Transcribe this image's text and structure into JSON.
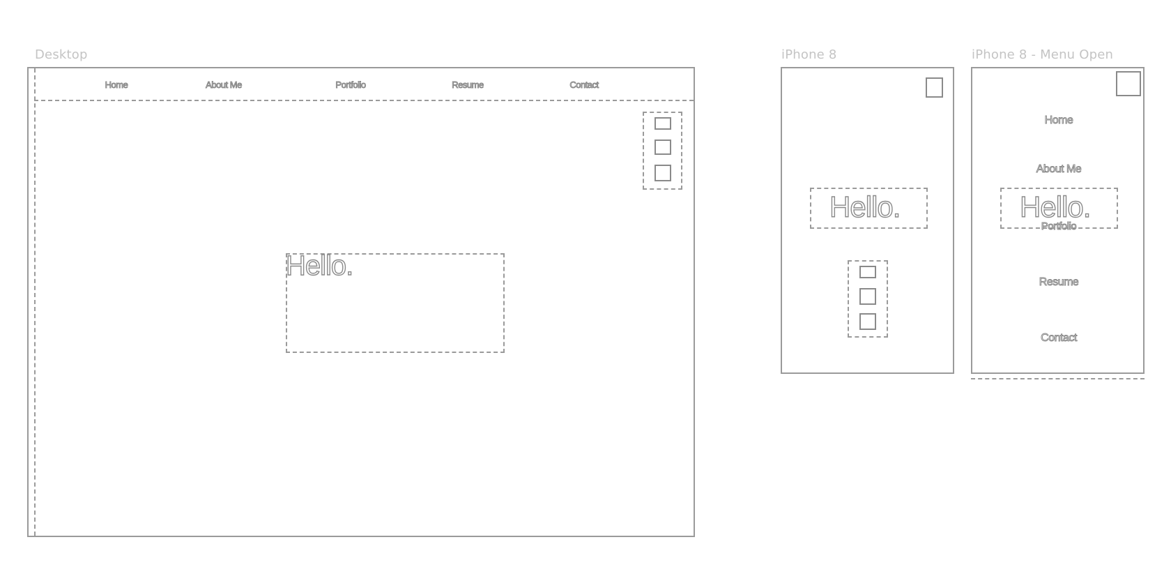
{
  "artboards": {
    "desktop": {
      "label": "Desktop",
      "nav": [
        "Home",
        "About Me",
        "Portfolio",
        "Resume",
        "Contact"
      ],
      "hero_text": "Hello."
    },
    "iphone8": {
      "label": "iPhone 8",
      "hero_text": "Hello."
    },
    "iphone8_menu_open": {
      "label": "iPhone 8 - Menu Open",
      "menu": [
        "Home",
        "About Me",
        "Portfolio",
        "Resume",
        "Contact"
      ],
      "hero_text": "Hello."
    }
  },
  "colors": {
    "stroke": "#9a9a9a",
    "label": "#c4c4c4",
    "background": "#ffffff"
  }
}
